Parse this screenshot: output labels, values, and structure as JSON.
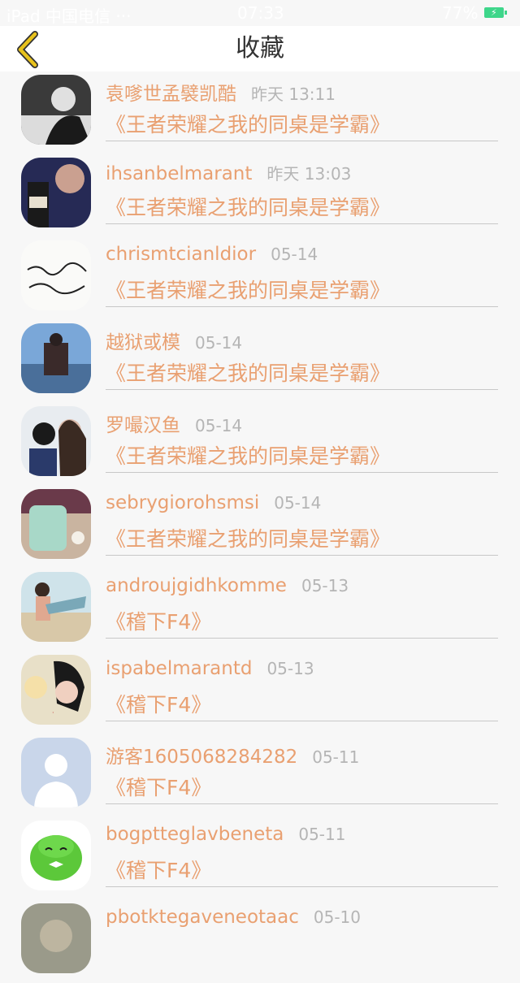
{
  "status_bar": {
    "carrier": "iPad 中国电信 ···",
    "time": "07:33",
    "battery": "77%",
    "battery_icon": "battery-charging-icon"
  },
  "header": {
    "title": "收藏",
    "back_icon": "chevron-left-icon",
    "back_color": "#e8c21c"
  },
  "colors": {
    "accent": "#e9a071",
    "time_gray": "#b5b5b5"
  },
  "items": [
    {
      "name": "袁嗲世孟襞凯酷",
      "time": "昨天 13:11",
      "book": "《王者荣耀之我的同桌是学霸》",
      "avatar": "avatar-photo"
    },
    {
      "name": "ihsanbelmarant",
      "time": "昨天 13:03",
      "book": "《王者荣耀之我的同桌是学霸》",
      "avatar": "avatar-photo"
    },
    {
      "name": "chrismtcianldior",
      "time": "05-14",
      "book": "《王者荣耀之我的同桌是学霸》",
      "avatar": "avatar-calligraphy"
    },
    {
      "name": "越狱或模",
      "time": "05-14",
      "book": "《王者荣耀之我的同桌是学霸》",
      "avatar": "avatar-photo"
    },
    {
      "name": "罗嘬汉鱼",
      "time": "05-14",
      "book": "《王者荣耀之我的同桌是学霸》",
      "avatar": "avatar-photo"
    },
    {
      "name": "sebrygiorohsmsi",
      "time": "05-14",
      "book": "《王者荣耀之我的同桌是学霸》",
      "avatar": "avatar-photo"
    },
    {
      "name": "androujgidhkomme",
      "time": "05-13",
      "book": "《稽下F4》",
      "avatar": "avatar-photo"
    },
    {
      "name": "ispabelmarantd",
      "time": "05-13",
      "book": "《稽下F4》",
      "avatar": "avatar-photo"
    },
    {
      "name": "游客1605068284282",
      "time": "05-11",
      "book": "《稽下F4》",
      "avatar": "avatar-default-person"
    },
    {
      "name": "bogptteglavbeneta",
      "time": "05-11",
      "book": "《稽下F4》",
      "avatar": "avatar-cartoon"
    },
    {
      "name": "pbotktegaveneotaac",
      "time": "05-10",
      "book": "",
      "avatar": "avatar-photo"
    }
  ]
}
